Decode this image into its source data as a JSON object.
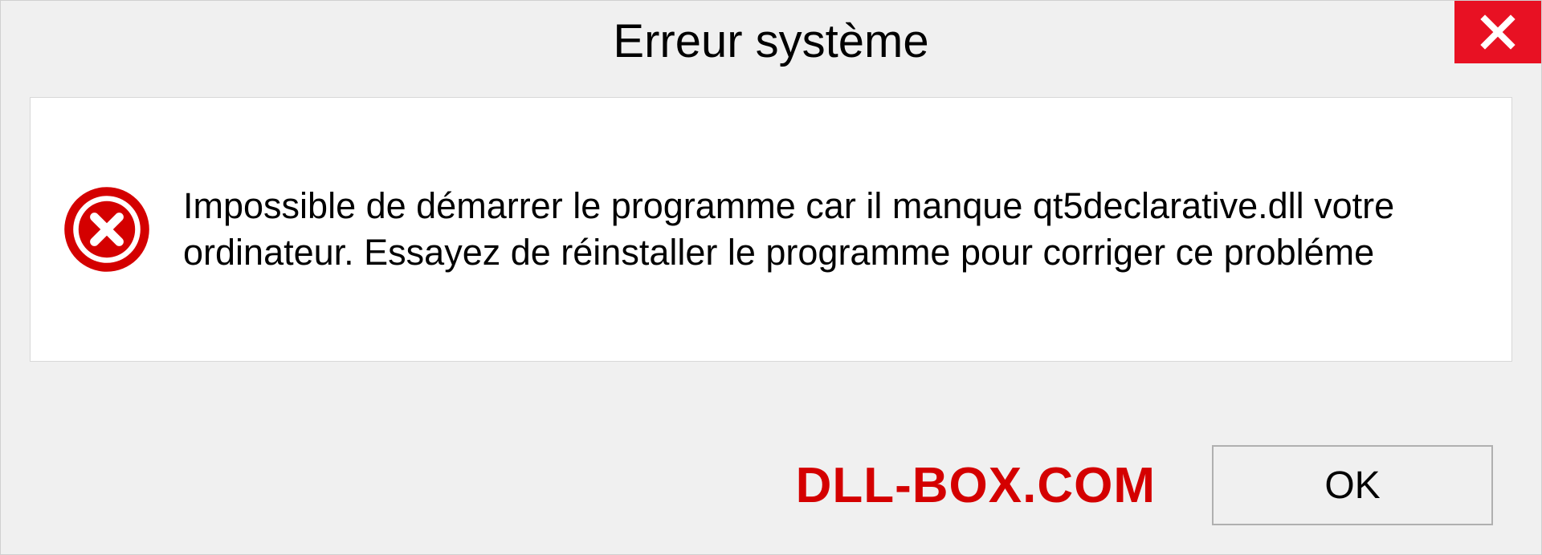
{
  "dialog": {
    "title": "Erreur système",
    "message": "Impossible de démarrer le programme car il manque qt5declarative.dll votre ordinateur. Essayez de réinstaller le programme pour corriger ce probléme",
    "ok_label": "OK"
  },
  "brand": "DLL-BOX.COM"
}
